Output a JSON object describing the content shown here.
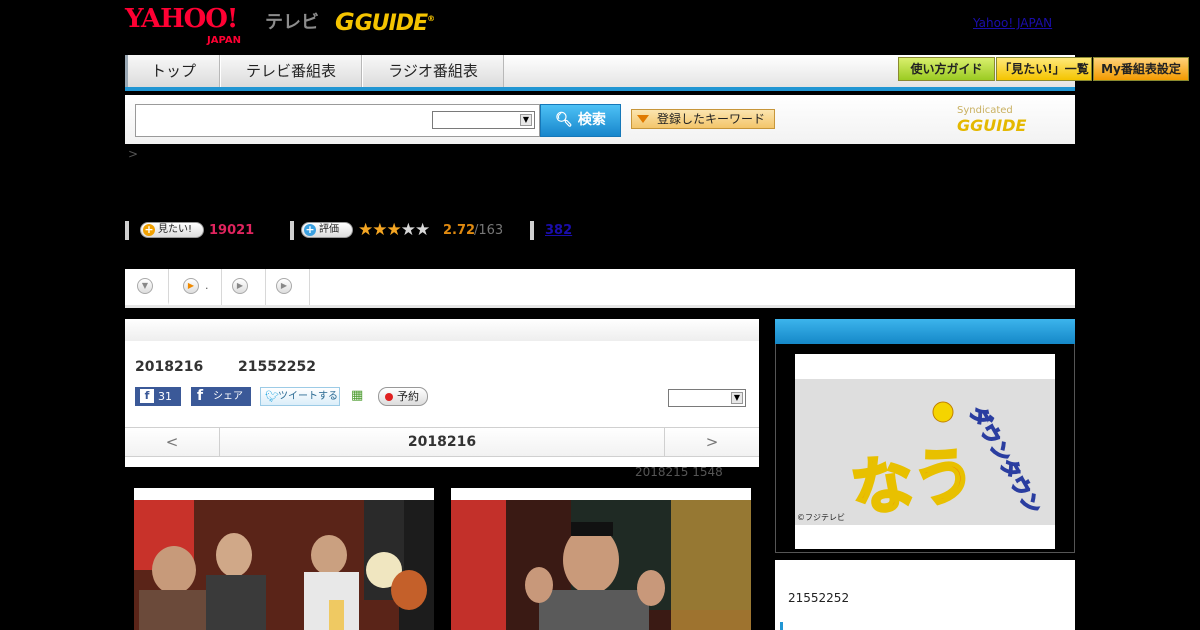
{
  "header": {
    "yahoo_logo": "YAHOO!",
    "yahoo_sub": "JAPAN",
    "tv_label": "テレビ",
    "gguide_logo": "GUIDE",
    "yahoo_japan_link": "Yahoo! JAPAN"
  },
  "nav": {
    "tabs": [
      "トップ",
      "テレビ番組表",
      "ラジオ番組表"
    ],
    "right_buttons": [
      "使い方ガイド",
      "「見たい!」一覧",
      "My番組表設定"
    ]
  },
  "search": {
    "input_value": "",
    "select_value": "",
    "search_label": "検索",
    "keyword_label": "登録したキーワード",
    "syndicated": "Syndicated"
  },
  "breadcrumb": ">",
  "rating": {
    "mitai_label": "見たい!",
    "mitai_count": "19021",
    "hyouka_label": "評価",
    "stars_value": 2.72,
    "stars_max": 5,
    "score": "2.72",
    "score_count": "/163",
    "link_number": "382"
  },
  "subtabs": [
    {
      "label": "",
      "icon": "chevron-down-icon"
    },
    {
      "label": ".",
      "icon": "play-icon"
    },
    {
      "label": "",
      "icon": "play-icon"
    },
    {
      "label": "",
      "icon": "play-icon"
    }
  ],
  "program": {
    "date": "2018216",
    "time": "21552252",
    "fb_count": "31",
    "fb_share": "シェア",
    "tweet": "ツイートする",
    "reserve": "予約",
    "select_value": "",
    "pager_prev": "<",
    "pager_date": "2018216",
    "pager_next": ">",
    "updated": "2018215  1548"
  },
  "side": {
    "title_a": "ダウンタウン",
    "title_b": "なう",
    "copyright": "©フジテレビ",
    "time": "21552252"
  },
  "colors": {
    "accent_blue": "#2196d3",
    "yahoo_red": "#ff0033",
    "gguide_yellow": "#f5c400",
    "mitai_pink": "#e0245e",
    "score_orange": "#e08a10"
  }
}
